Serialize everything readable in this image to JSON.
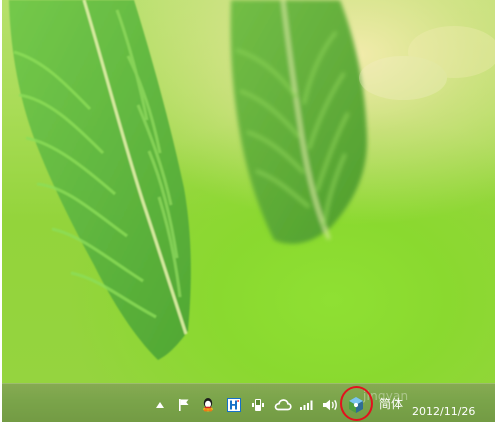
{
  "desktop": {
    "wallpaper": "green-leaf-wallpaper"
  },
  "taskbar": {
    "tray": {
      "icons": [
        "chevron-up-icon",
        "action-center-flag-icon",
        "qq-icon",
        "h-app-icon",
        "usb-device-icon",
        "cloud-icon",
        "wifi-signal-icon",
        "volume-icon",
        "ime-settings-icon"
      ],
      "ime_label": "简体",
      "watermark_text": "jingyan",
      "clock_date": "2012/11/26"
    }
  },
  "colors": {
    "taskbar": "#7aa44a",
    "highlight_ring": "#e2121d"
  }
}
